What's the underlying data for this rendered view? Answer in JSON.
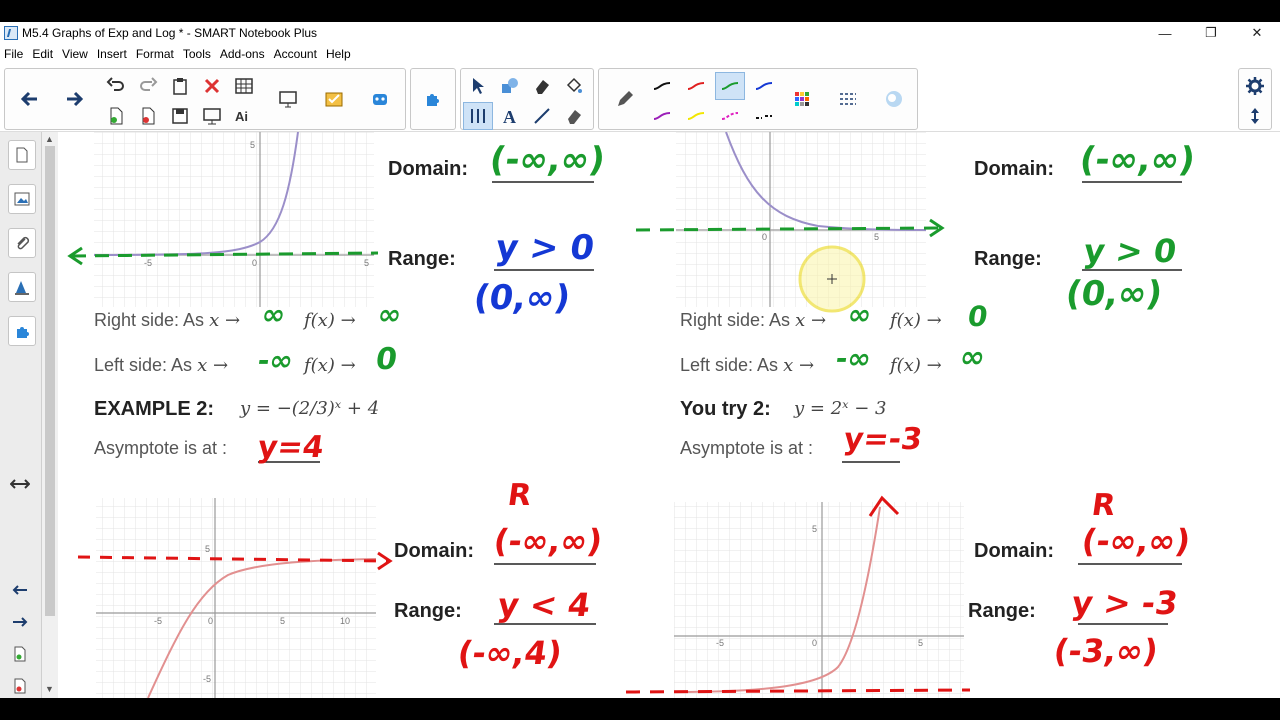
{
  "window": {
    "title": "M5.4 Graphs of Exp and Log * - SMART Notebook Plus",
    "controls": [
      "—",
      "❐",
      "✕"
    ]
  },
  "menu": [
    "File",
    "Edit",
    "View",
    "Insert",
    "Format",
    "Tools",
    "Add-ons",
    "Account",
    "Help"
  ],
  "toolbar": {
    "pen_colors": [
      "#111111",
      "#e02020",
      "#1a9b2d",
      "#1438d4",
      "#9b1fb8",
      "#f2e600",
      "#e020c0",
      "#111111"
    ],
    "selected_pen": "green-pen"
  },
  "page": {
    "left_top": {
      "domain_label": "Domain:",
      "domain_answer": "(-∞,∞)",
      "range_label": "Range:",
      "range_answer": "y > 0",
      "range_interval": "(0,∞)",
      "right_side_prefix": "Right side:  As",
      "right_side_x_to": "∞",
      "right_side_f_to": "∞",
      "left_side_prefix": "Left side:   As",
      "left_side_x_to": "-∞",
      "left_side_f_to": "0"
    },
    "example2": {
      "title": "EXAMPLE 2:",
      "equation": "y = −(2/3)ˣ + 4",
      "asymptote_label": "Asymptote is at :",
      "asymptote_answer": "y=4",
      "domain_label": "Domain:",
      "domain_note": "R",
      "domain_answer": "(-∞,∞)",
      "range_label": "Range:",
      "range_answer": "y < 4",
      "range_interval": "(-∞,4)"
    },
    "right_top": {
      "domain_label": "Domain:",
      "domain_answer": "(-∞,∞)",
      "range_label": "Range:",
      "range_answer": "y > 0",
      "range_interval": "(0,∞)",
      "right_side_prefix": "Right side:  As",
      "right_side_x_to": "∞",
      "right_side_f_to": "0",
      "left_side_prefix": "Left side:   As",
      "left_side_x_to": "-∞",
      "left_side_f_to": "∞"
    },
    "you_try2": {
      "title": "You try 2:",
      "equation": "y = 2ˣ − 3",
      "asymptote_label": "Asymptote is at :",
      "asymptote_answer": "y=-3",
      "domain_label": "Domain:",
      "domain_note": "R",
      "domain_answer": "(-∞,∞)",
      "range_label": "Range:",
      "range_answer": "y > -3",
      "range_interval": "(-3,∞)"
    },
    "graph_ticks": {
      "top_left": [
        "5",
        "-5",
        "0",
        "5"
      ],
      "top_right": [
        "0",
        "5"
      ],
      "bottom_left": [
        "5",
        "-5",
        "0",
        "5",
        "10",
        "-5"
      ],
      "bottom_right": [
        "5",
        "-5",
        "0",
        "5"
      ]
    },
    "fx_text": "f(x) →",
    "x_arrow": "x →"
  }
}
